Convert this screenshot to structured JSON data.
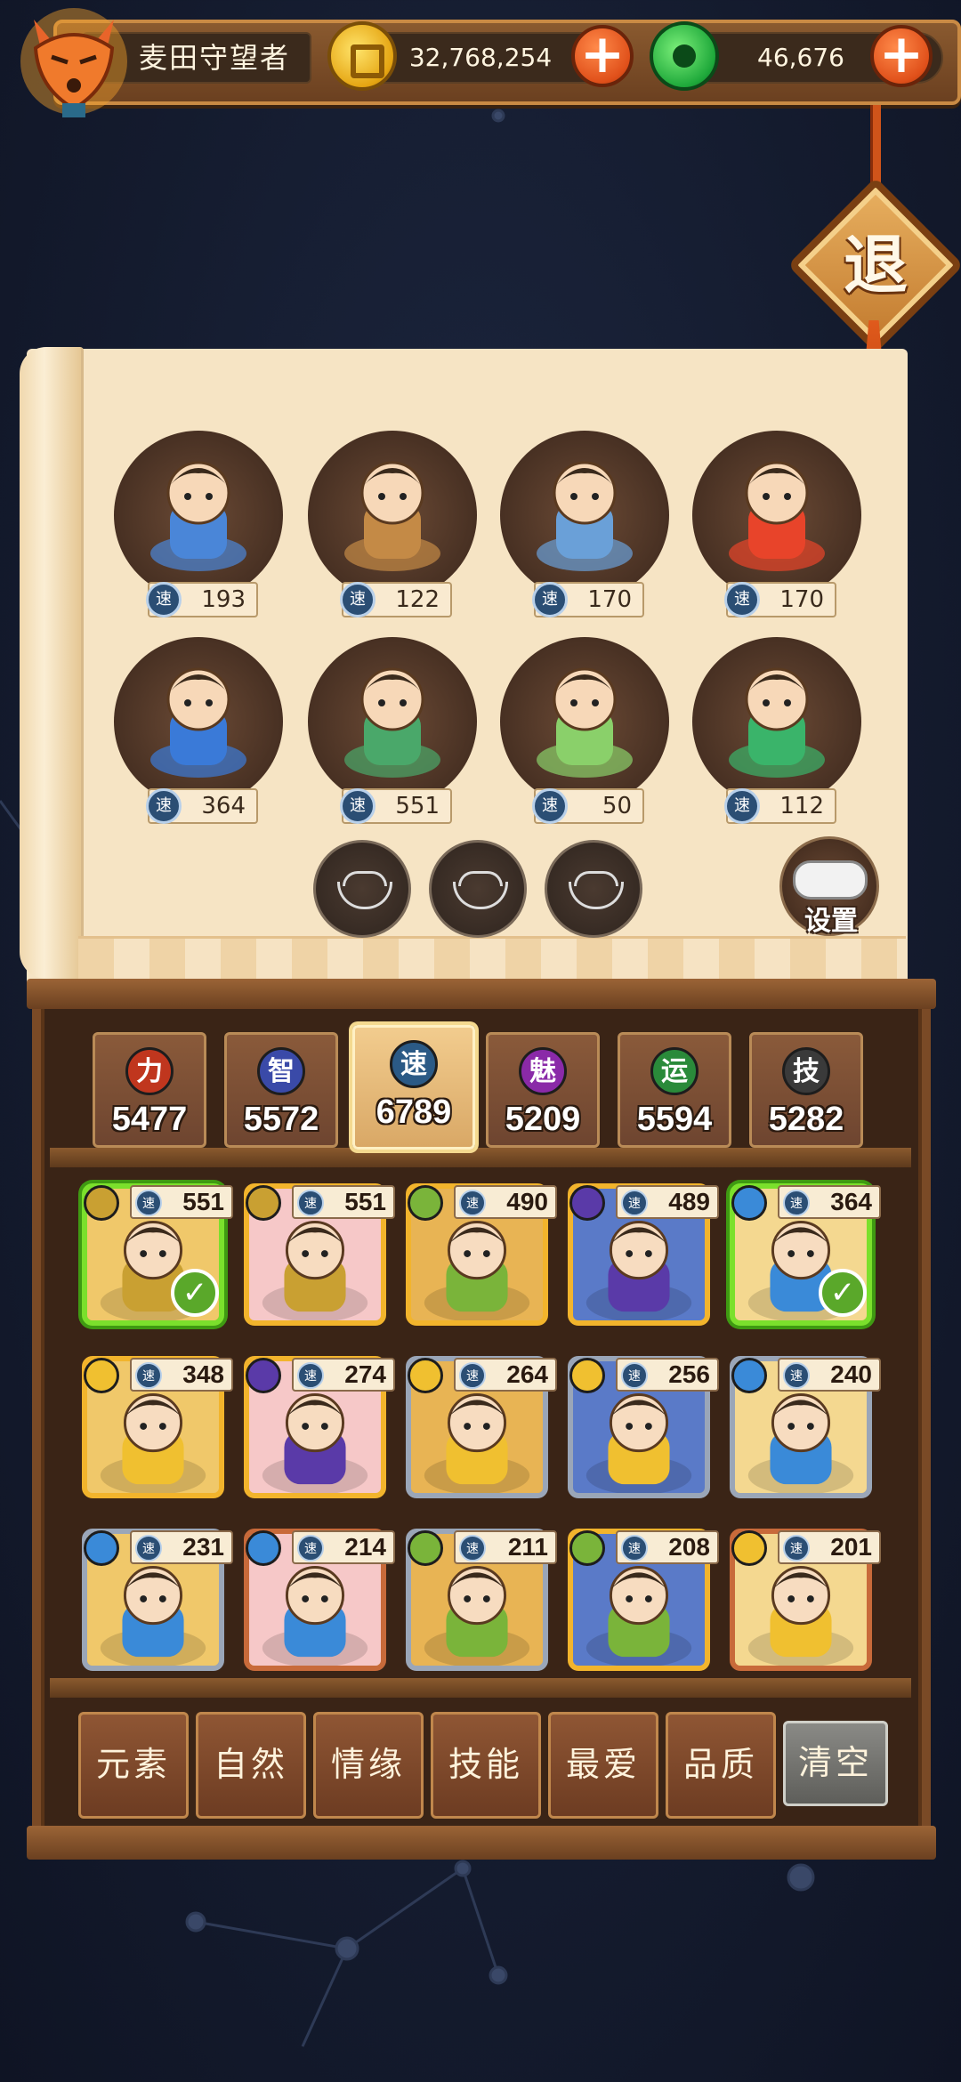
{
  "player": {
    "name": "麦田守望者"
  },
  "currency": {
    "gold": "32,768,254",
    "jade": "46,676"
  },
  "exit_label": "退",
  "settings_label": "设置",
  "speed_label": "速",
  "team": [
    {
      "speed": "193",
      "color": "#4a86d8"
    },
    {
      "speed": "122",
      "color": "#c48a46"
    },
    {
      "speed": "170",
      "color": "#6aa0d8"
    },
    {
      "speed": "170",
      "color": "#e8442a"
    },
    {
      "speed": "364",
      "color": "#3a7ad8"
    },
    {
      "speed": "551",
      "color": "#4aa86a"
    },
    {
      "speed": "50",
      "color": "#8ad06a"
    },
    {
      "speed": "112",
      "color": "#3ab46a"
    }
  ],
  "stats": [
    {
      "badge": "力",
      "value": "5477",
      "color": "#c0361e"
    },
    {
      "badge": "智",
      "value": "5572",
      "color": "#3a4aa8"
    },
    {
      "badge": "速",
      "value": "6789",
      "color": "#2b5a86"
    },
    {
      "badge": "魅",
      "value": "5209",
      "color": "#8a2aa8"
    },
    {
      "badge": "运",
      "value": "5594",
      "color": "#2a8a3a"
    },
    {
      "badge": "技",
      "value": "5282",
      "color": "#3a3a3a"
    }
  ],
  "roster": [
    {
      "speed": "551",
      "element": "earth",
      "selected": true
    },
    {
      "speed": "551",
      "element": "earth",
      "selected": false
    },
    {
      "speed": "490",
      "element": "wood",
      "selected": false
    },
    {
      "speed": "489",
      "element": "dark",
      "selected": false
    },
    {
      "speed": "364",
      "element": "water",
      "selected": true
    },
    {
      "speed": "348",
      "element": "light",
      "selected": false
    },
    {
      "speed": "274",
      "element": "dark",
      "selected": false
    },
    {
      "speed": "264",
      "element": "light",
      "selected": false
    },
    {
      "speed": "256",
      "element": "light",
      "selected": false
    },
    {
      "speed": "240",
      "element": "water",
      "selected": false
    },
    {
      "speed": "231",
      "element": "water",
      "selected": false
    },
    {
      "speed": "214",
      "element": "water",
      "selected": false
    },
    {
      "speed": "211",
      "element": "wood",
      "selected": false
    },
    {
      "speed": "208",
      "element": "wood",
      "selected": false
    },
    {
      "speed": "201",
      "element": "light",
      "selected": false
    }
  ],
  "filters": [
    "元素",
    "自然",
    "情缘",
    "技能",
    "最爱",
    "品质"
  ],
  "clear_label": "清空",
  "colors": {
    "gold_frame": "#f2b42c",
    "silver_frame": "#9aa6b8",
    "copper_frame": "#c86a3a",
    "selected_frame": "#7be02c"
  }
}
